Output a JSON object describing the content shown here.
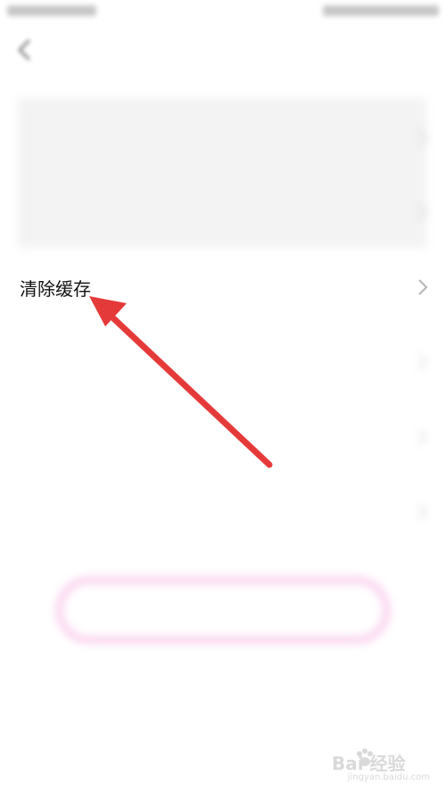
{
  "status_bar": {
    "left": "",
    "right": ""
  },
  "nav": {
    "title": ""
  },
  "rows": [
    {
      "label": "",
      "value": "",
      "chevron": true
    },
    {
      "label": "",
      "value": "",
      "chevron": true
    },
    {
      "label": "清除缓存",
      "value": "",
      "chevron": true
    },
    {
      "label": "",
      "value": "",
      "chevron": true
    },
    {
      "label": "",
      "value": "",
      "chevron": true
    },
    {
      "label": "",
      "value": "",
      "chevron": true
    }
  ],
  "logout": {
    "label": ""
  },
  "annotation": {
    "arrow_color": "#e53a3a"
  },
  "watermark": {
    "brand": "Bai  经验",
    "url": "jingyan.baidu.com"
  },
  "colors": {
    "accent_pink": "#e055c8",
    "button_border": "#f6a9df",
    "chevron": "#b5b5b5"
  }
}
